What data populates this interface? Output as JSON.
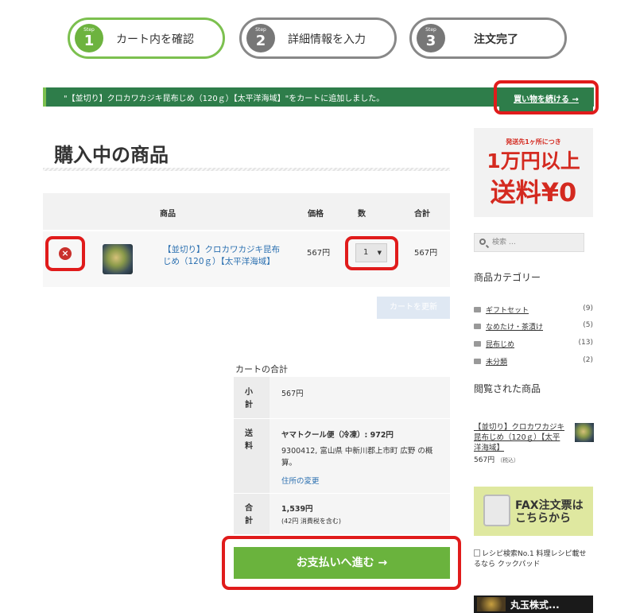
{
  "steps": [
    {
      "step": "Step",
      "num": "1",
      "label": "カート内を確認"
    },
    {
      "step": "Step",
      "num": "2",
      "label": "詳細情報を入力"
    },
    {
      "step": "Step",
      "num": "3",
      "label": "注文完了"
    }
  ],
  "notice": {
    "message": "\"【並切り】クロカワカジキ昆布じめ（120ｇ）【太平洋海域】\"をカートに追加しました。",
    "continue_label": "買い物を続ける →"
  },
  "page_title": "購入中の商品",
  "cart": {
    "headers": {
      "product": "商品",
      "price": "価格",
      "qty": "数",
      "total": "合計"
    },
    "item": {
      "remove_icon": "×",
      "name": "【並切り】クロカワカジキ昆布じめ（120ｇ）【太平洋海域】",
      "price": "567円",
      "qty": "1",
      "subtotal": "567円"
    },
    "update_label": "カートを更新"
  },
  "totals": {
    "heading": "カートの合計",
    "subtotal_label": "小計",
    "subtotal_value": "567円",
    "shipping_label": "送料",
    "shipping_method": "ヤマトクール便（冷凍）: 972円",
    "shipping_addr": "9300412, 富山県 中新川郡上市町 広野 の概算。",
    "change_addr": "住所の変更",
    "total_label": "合計",
    "total_value": "1,539円",
    "total_tax": "(42円 消費税を含む)"
  },
  "checkout_label": "お支払いへ進む →",
  "sidebar": {
    "banner": {
      "line1": "発送先1ヶ所につき",
      "line2": "1万円以上",
      "line3": "送料¥0"
    },
    "search_placeholder": "検索 …",
    "categories_title": "商品カテゴリー",
    "categories": [
      {
        "name": "ギフトセット",
        "count": "(9)"
      },
      {
        "name": "なめたけ・茶漬け",
        "count": "(5)"
      },
      {
        "name": "昆布じめ",
        "count": "(13)"
      },
      {
        "name": "未分類",
        "count": "(2)"
      }
    ],
    "viewed_title": "閲覧された商品",
    "viewed_name": "【並切り】クロカワカジキ昆布じめ（120ｇ）【太平洋海域】",
    "viewed_price": "567円",
    "viewed_tax": "（税込）",
    "fax_text": "FAX注文票はこちらから",
    "recipe_alt": "レシピ検索No.1 料理レシピ載せるなら クックパッド",
    "maru_text": "丸玉株式..."
  },
  "colors": {
    "accent_green": "#6ab33d",
    "notice_green": "#2e7d4a",
    "highlight_red": "#e01b1b",
    "link_blue": "#2a6fb0"
  }
}
